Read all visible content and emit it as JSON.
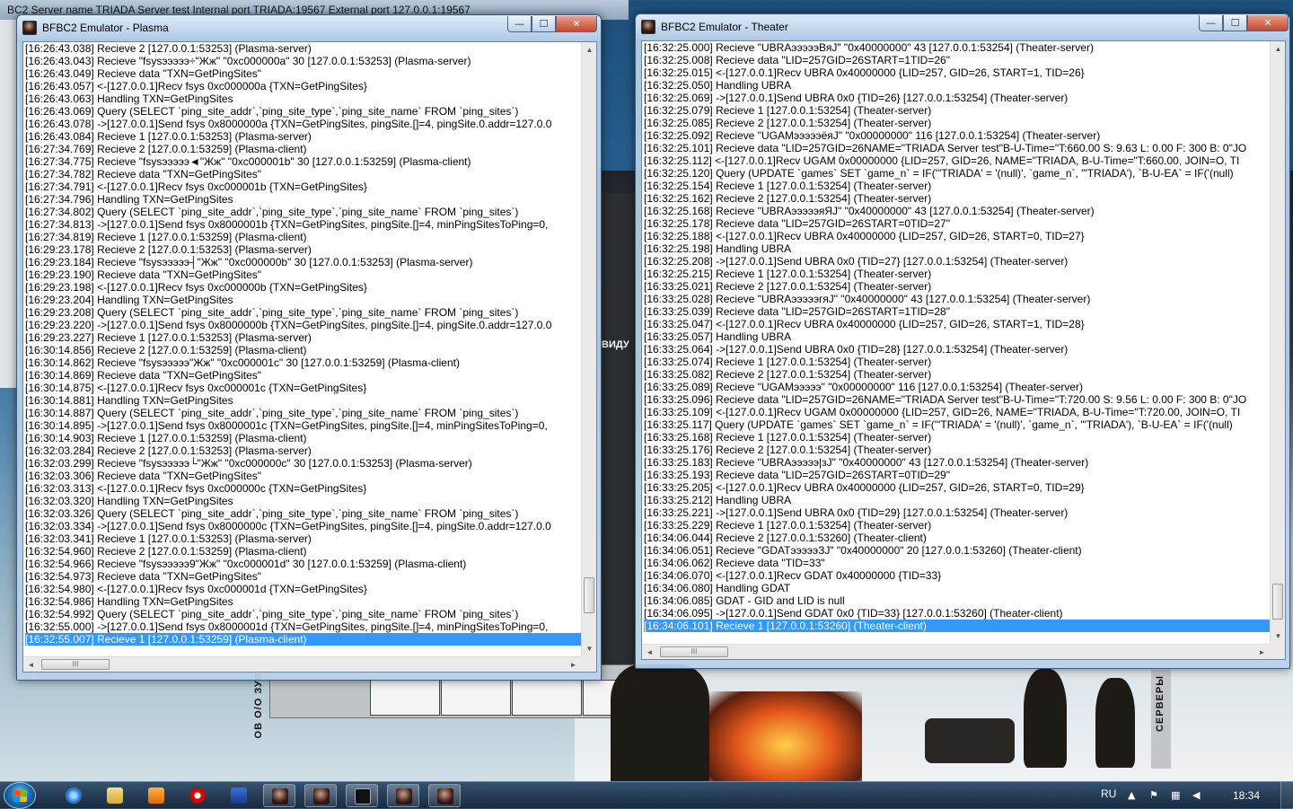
{
  "behind_window": {
    "title": "BC2      Server name TRIADA Server test      Internal port TRIADA:19567      External port 127.0.0.1:19567"
  },
  "background": {
    "label_left": "ОВ О/О ЗУВА",
    "label_right": "СЕРВЕРЫ",
    "label_mid": "ВИДУ"
  },
  "plasma_window": {
    "title": "BFBC2 Emulator - Plasma",
    "buttons": {
      "min": "—",
      "max": "☐",
      "close": "✕"
    },
    "log_lines": [
      "[16:26:43.038] Recieve 2 [127.0.0.1:53253] (Plasma-server)",
      "[16:26:43.043] Recieve \"fsysэээээ÷\"Жж\" \"0xc000000a\" 30 [127.0.0.1:53253] (Plasma-server)",
      "[16:26:43.049] Recieve data \"TXN=GetPingSites\"",
      "[16:26:43.057] <-[127.0.0.1]Recv fsys 0xc000000a {TXN=GetPingSites}",
      "[16:26:43.063] Handling TXN=GetPingSites",
      "[16:26:43.069] Query (SELECT `ping_site_addr`,`ping_site_type`,`ping_site_name` FROM `ping_sites`)",
      "[16:26:43.078] ->[127.0.0.1]Send fsys 0x8000000a {TXN=GetPingSites, pingSite.[]=4, pingSite.0.addr=127.0.0",
      "[16:26:43.084] Recieve 1 [127.0.0.1:53253] (Plasma-server)",
      "[16:27:34.769] Recieve 2 [127.0.0.1:53259] (Plasma-client)",
      "[16:27:34.775] Recieve \"fsysэээээ◄\"Жж\" \"0xc000001b\" 30 [127.0.0.1:53259] (Plasma-client)",
      "[16:27:34.782] Recieve data \"TXN=GetPingSites\"",
      "[16:27:34.791] <-[127.0.0.1]Recv fsys 0xc000001b {TXN=GetPingSites}",
      "[16:27:34.796] Handling TXN=GetPingSites",
      "[16:27:34.802] Query (SELECT `ping_site_addr`,`ping_site_type`,`ping_site_name` FROM `ping_sites`)",
      "[16:27:34.813] ->[127.0.0.1]Send fsys 0x8000001b {TXN=GetPingSites, pingSite.[]=4, minPingSitesToPing=0,",
      "[16:27:34.819] Recieve 1 [127.0.0.1:53259] (Plasma-client)",
      "[16:29:23.178] Recieve 2 [127.0.0.1:53253] (Plasma-server)",
      "[16:29:23.184] Recieve \"fsysэээээ┤\"Жж\" \"0xc000000b\" 30 [127.0.0.1:53253] (Plasma-server)",
      "[16:29:23.190] Recieve data \"TXN=GetPingSites\"",
      "[16:29:23.198] <-[127.0.0.1]Recv fsys 0xc000000b {TXN=GetPingSites}",
      "[16:29:23.204] Handling TXN=GetPingSites",
      "[16:29:23.208] Query (SELECT `ping_site_addr`,`ping_site_type`,`ping_site_name` FROM `ping_sites`)",
      "[16:29:23.220] ->[127.0.0.1]Send fsys 0x8000000b {TXN=GetPingSites, pingSite.[]=4, pingSite.0.addr=127.0.0",
      "[16:29:23.227] Recieve 1 [127.0.0.1:53253] (Plasma-server)",
      "[16:30:14.856] Recieve 2 [127.0.0.1:53259] (Plasma-client)",
      "[16:30:14.862] Recieve \"fsysэээээ\"Жж\" \"0xc000001c\" 30 [127.0.0.1:53259] (Plasma-client)",
      "[16:30:14.869] Recieve data \"TXN=GetPingSites\"",
      "[16:30:14.875] <-[127.0.0.1]Recv fsys 0xc000001c {TXN=GetPingSites}",
      "[16:30:14.881] Handling TXN=GetPingSites",
      "[16:30:14.887] Query (SELECT `ping_site_addr`,`ping_site_type`,`ping_site_name` FROM `ping_sites`)",
      "[16:30:14.895] ->[127.0.0.1]Send fsys 0x8000001c {TXN=GetPingSites, pingSite.[]=4, minPingSitesToPing=0,",
      "[16:30:14.903] Recieve 1 [127.0.0.1:53259] (Plasma-client)",
      "[16:32:03.284] Recieve 2 [127.0.0.1:53253] (Plasma-server)",
      "[16:32:03.299] Recieve \"fsysэээээ└\"Жж\" \"0xc000000c\" 30 [127.0.0.1:53253] (Plasma-server)",
      "[16:32:03.306] Recieve data \"TXN=GetPingSites\"",
      "[16:32:03.313] <-[127.0.0.1]Recv fsys 0xc000000c {TXN=GetPingSites}",
      "[16:32:03.320] Handling TXN=GetPingSites",
      "[16:32:03.326] Query (SELECT `ping_site_addr`,`ping_site_type`,`ping_site_name` FROM `ping_sites`)",
      "[16:32:03.334] ->[127.0.0.1]Send fsys 0x8000000c {TXN=GetPingSites, pingSite.[]=4, pingSite.0.addr=127.0.0",
      "[16:32:03.341] Recieve 1 [127.0.0.1:53253] (Plasma-server)",
      "[16:32:54.960] Recieve 2 [127.0.0.1:53259] (Plasma-client)",
      "[16:32:54.966] Recieve \"fsysэээээ9\"Жж\" \"0xc000001d\" 30 [127.0.0.1:53259] (Plasma-client)",
      "[16:32:54.973] Recieve data \"TXN=GetPingSites\"",
      "[16:32:54.980] <-[127.0.0.1]Recv fsys 0xc000001d {TXN=GetPingSites}",
      "[16:32:54.986] Handling TXN=GetPingSites",
      "[16:32:54.992] Query (SELECT `ping_site_addr`,`ping_site_type`,`ping_site_name` FROM `ping_sites`)",
      "[16:32:55.000] ->[127.0.0.1]Send fsys 0x8000001d {TXN=GetPingSites, pingSite.[]=4, minPingSitesToPing=0,"
    ],
    "selected_line": "[16:32:55.007] Recieve 1 [127.0.0.1:53259] (Plasma-client)"
  },
  "theater_window": {
    "title": "BFBC2 Emulator - Theater",
    "buttons": {
      "min": "—",
      "max": "☐",
      "close": "✕"
    },
    "log_lines": [
      "[16:32:25.000] Recieve \"UBRAэээээВяЈ\" \"0x40000000\" 43 [127.0.0.1:53254] (Theater-server)",
      "[16:32:25.008] Recieve data \"LID=257GID=26START=1TID=26\"",
      "[16:32:25.015] <-[127.0.0.1]Recv UBRA 0x40000000 {LID=257, GID=26, START=1, TID=26}",
      "[16:32:25.050] Handling UBRA",
      "[16:32:25.069] ->[127.0.0.1]Send UBRA 0x0 {TID=26} [127.0.0.1:53254] (Theater-server)",
      "[16:32:25.079] Recieve 1 [127.0.0.1:53254] (Theater-server)",
      "[16:32:25.085] Recieve 2 [127.0.0.1:53254] (Theater-server)",
      "[16:32:25.092] Recieve \"UGAMэээээёяЈ\" \"0x00000000\" 116 [127.0.0.1:53254] (Theater-server)",
      "[16:32:25.101] Recieve data \"LID=257GID=26NAME=\"TRIADA Server test\"B-U-Time=\"T:660.00 S: 9.63 L: 0.00 F: 300 B: 0\"JO",
      "[16:32:25.112] <-[127.0.0.1]Recv UGAM 0x00000000 {LID=257, GID=26, NAME=\"TRIADA, B-U-Time=\"T:660.00, JOIN=O, TI",
      "[16:32:25.120] Query (UPDATE `games` SET `game_n` = IF('\"TRIADA' = '(null)', `game_n`, '\"TRIADA'), `B-U-EA` = IF('(null)",
      "[16:32:25.154] Recieve 1 [127.0.0.1:53254] (Theater-server)",
      "[16:32:25.162] Recieve 2 [127.0.0.1:53254] (Theater-server)",
      "[16:32:25.168] Recieve \"UBRAэээээяЯЈ\" \"0x40000000\" 43 [127.0.0.1:53254] (Theater-server)",
      "[16:32:25.178] Recieve data \"LID=257GID=26START=0TID=27\"",
      "[16:32:25.188] <-[127.0.0.1]Recv UBRA 0x40000000 {LID=257, GID=26, START=0, TID=27}",
      "[16:32:25.198] Handling UBRA",
      "[16:32:25.208] ->[127.0.0.1]Send UBRA 0x0 {TID=27} [127.0.0.1:53254] (Theater-server)",
      "[16:32:25.215] Recieve 1 [127.0.0.1:53254] (Theater-server)",
      "[16:33:25.021] Recieve 2 [127.0.0.1:53254] (Theater-server)",
      "[16:33:25.028] Recieve \"UBRAэээээгяЈ\" \"0x40000000\" 43 [127.0.0.1:53254] (Theater-server)",
      "[16:33:25.039] Recieve data \"LID=257GID=26START=1TID=28\"",
      "[16:33:25.047] <-[127.0.0.1]Recv UBRA 0x40000000 {LID=257, GID=26, START=1, TID=28}",
      "[16:33:25.057] Handling UBRA",
      "[16:33:25.064] ->[127.0.0.1]Send UBRA 0x0 {TID=28} [127.0.0.1:53254] (Theater-server)",
      "[16:33:25.074] Recieve 1 [127.0.0.1:53254] (Theater-server)",
      "[16:33:25.082] Recieve 2 [127.0.0.1:53254] (Theater-server)",
      "[16:33:25.089] Recieve \"UGAMэээээ\" \"0x00000000\" 116 [127.0.0.1:53254] (Theater-server)",
      "[16:33:25.096] Recieve data \"LID=257GID=26NAME=\"TRIADA Server test\"B-U-Time=\"T:720.00 S: 9.56 L: 0.00 F: 300 B: 0\"JO",
      "[16:33:25.109] <-[127.0.0.1]Recv UGAM 0x00000000 {LID=257, GID=26, NAME=\"TRIADA, B-U-Time=\"T:720.00, JOIN=O, TI",
      "[16:33:25.117] Query (UPDATE `games` SET `game_n` = IF('\"TRIADA' = '(null)', `game_n`, '\"TRIADA'), `B-U-EA` = IF('(null)",
      "[16:33:25.168] Recieve 1 [127.0.0.1:53254] (Theater-server)",
      "[16:33:25.176] Recieve 2 [127.0.0.1:53254] (Theater-server)",
      "[16:33:25.183] Recieve \"UBRAэээээ|зЈ\" \"0x40000000\" 43 [127.0.0.1:53254] (Theater-server)",
      "[16:33:25.193] Recieve data \"LID=257GID=26START=0TID=29\"",
      "[16:33:25.205] <-[127.0.0.1]Recv UBRA 0x40000000 {LID=257, GID=26, START=0, TID=29}",
      "[16:33:25.212] Handling UBRA",
      "[16:33:25.221] ->[127.0.0.1]Send UBRA 0x0 {TID=29} [127.0.0.1:53254] (Theater-server)",
      "[16:33:25.229] Recieve 1 [127.0.0.1:53254] (Theater-server)",
      "[16:34:06.044] Recieve 2 [127.0.0.1:53260] (Theater-client)",
      "[16:34:06.051] Recieve \"GDATэээээЗЈ\" \"0x40000000\" 20 [127.0.0.1:53260] (Theater-client)",
      "[16:34:06.062] Recieve data \"TID=33\"",
      "[16:34:06.070] <-[127.0.0.1]Recv GDAT 0x40000000 {TID=33}",
      "[16:34:06.080] Handling GDAT",
      "[16:34:06.085] GDAT - GID and LID is null",
      "[16:34:06.095] ->[127.0.0.1]Send GDAT 0x0 {TID=33} [127.0.0.1:53260] (Theater-client)"
    ],
    "selected_line": "[16:34:06.101] Recieve 1 [127.0.0.1:53260] (Theater-client)"
  },
  "scroll": {
    "up": "▲",
    "down": "▼",
    "left": "◄",
    "right": "►",
    "grip": "III"
  },
  "taskbar": {
    "language": "RU",
    "clock": "18:34"
  },
  "colors": {
    "selection": "#3399ff"
  }
}
